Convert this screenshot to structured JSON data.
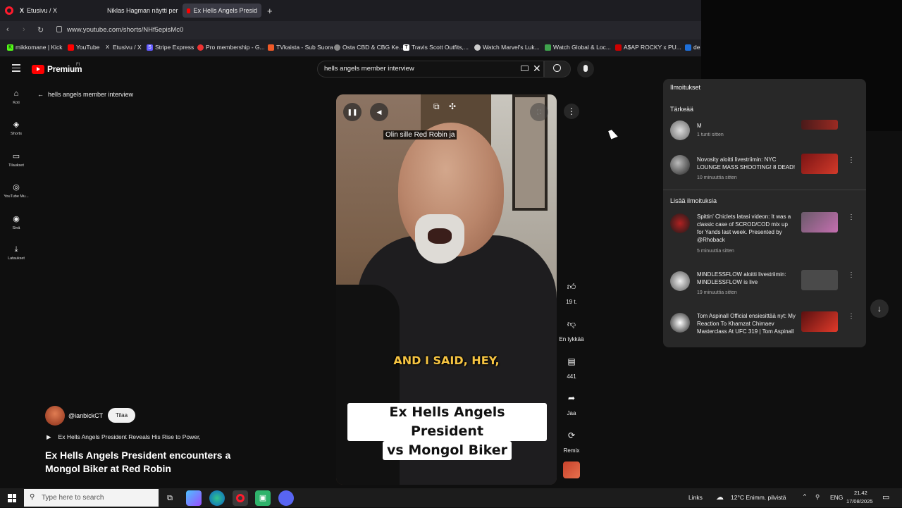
{
  "browser": {
    "tabs": [
      {
        "label": "Etusivu / X",
        "icon": "x-logo-icon"
      },
      {
        "label": "Niklas Hagman näytti per",
        "icon": "youtube-icon"
      },
      {
        "label": "Ex Hells Angels Presid",
        "icon": "youtube-icon"
      }
    ],
    "url": "www.youtube.com/shorts/NHf5episMc0",
    "bookmarks": [
      "mikkomane | Kick",
      "YouTube",
      "Etusivu / X",
      "Stripe Express",
      "Pro membership - G...",
      "TVkaista - Sub Suora",
      "Osta CBD & CBG Ke...",
      "Travis Scott Outfits,...",
      "Watch Marvel's Luk...",
      "Watch Global & Loc...",
      "A$AP ROCKY x PU...",
      "de"
    ]
  },
  "youtube": {
    "brand": "Premium",
    "region": "FI",
    "search_query": "hells angels member interview",
    "back_label": "hells angels member interview",
    "nav": [
      {
        "label": "Koti",
        "icon": "home-icon"
      },
      {
        "label": "Shorts",
        "icon": "shorts-icon"
      },
      {
        "label": "Tilaukset",
        "icon": "subscriptions-icon"
      },
      {
        "label": "YouTube Mu...",
        "icon": "youtube-music-icon"
      },
      {
        "label": "Sinä",
        "icon": "user-icon"
      },
      {
        "label": "Lataukset",
        "icon": "download-icon"
      }
    ]
  },
  "video": {
    "caption_top": "Olin sille Red Robin ja",
    "caption_yellow": "AND I SAID, HEY,",
    "title_overlay_line1": "Ex Hells Angels President",
    "title_overlay_line2": "vs Mongol Biker",
    "actions": {
      "likes": "19 t.",
      "dislike": "En tykkää",
      "comments": "441",
      "share": "Jaa",
      "remix": "Remix"
    }
  },
  "channel": {
    "name": "@ianbickCT",
    "subscribe": "Tilaa",
    "playlist": "Ex Hells Angels President Reveals His Rise to Power,",
    "title": "Ex Hells Angels President encounters a Mongol Biker at Red Robin"
  },
  "notifications": {
    "header": "Ilmoitukset",
    "section_important": "Tärkeää",
    "section_more": "Lisää ilmoituksia",
    "items": [
      {
        "text": "M",
        "time": "1 tunti sitten"
      },
      {
        "text": "Novosity aloitti livestriimin: NYC LOUNGE MASS SHOOTING! 8 DEAD!",
        "time": "10 minuuttia sitten"
      },
      {
        "text": "Spittin' Chiclets latasi videon: It was a classic case of SCROD/COD mix up for Yands last week. Presented by @Rhoback",
        "time": "5 minuuttia sitten"
      },
      {
        "text": "MINDLESSFLOW aloitti livestriimin: MINDLESSFLOW is live",
        "time": "19 minuuttia sitten"
      },
      {
        "text": "Tom Aspinall Official ensiesittää nyt: My Reaction To Khamzat Chimaev Masterclass At UFC 319 | Tom Aspinall",
        "time": ""
      }
    ]
  },
  "taskbar": {
    "search_placeholder": "Type here to search",
    "links": "Links",
    "weather": "12°C  Enimm. pilvistä",
    "language": "ENG",
    "time": "21.42",
    "date": "17/08/2025"
  }
}
